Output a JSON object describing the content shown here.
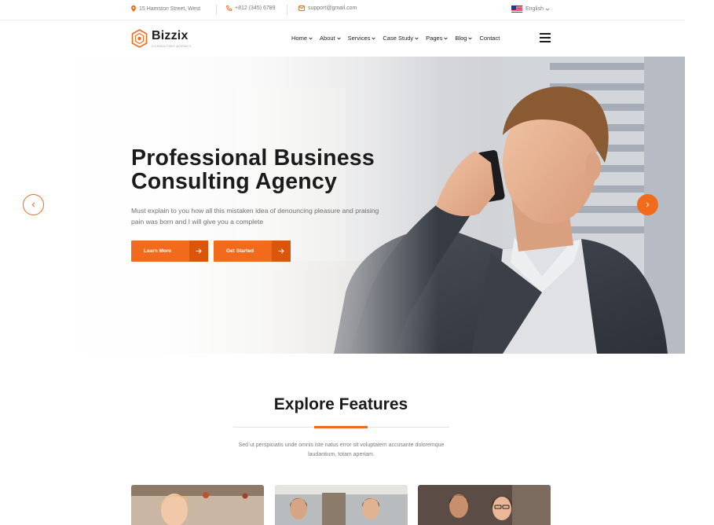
{
  "topbar": {
    "address": "15 Hamston Street, West",
    "phone": "+812 (345) 6789",
    "email": "support@gmail.com",
    "language": "English"
  },
  "brand": {
    "name": "Bizzix",
    "tagline": "Consulting Agency",
    "accent_color": "#f26a1b"
  },
  "nav": {
    "items": [
      {
        "label": "Home",
        "dropdown": true
      },
      {
        "label": "About",
        "dropdown": true
      },
      {
        "label": "Services",
        "dropdown": true
      },
      {
        "label": "Case Study",
        "dropdown": true
      },
      {
        "label": "Pages",
        "dropdown": true
      },
      {
        "label": "Blog",
        "dropdown": true
      },
      {
        "label": "Contact",
        "dropdown": false
      }
    ],
    "menu_icon": "hamburger-icon"
  },
  "hero": {
    "title_line1": "Professional Business",
    "title_line2": "Consulting Agency",
    "description": "Must explain to you how all this mistaken idea of denouncing pleasure and praising pain was born and I will give you a complete",
    "primary_button": "Learn More",
    "secondary_button": "Get Started",
    "prev_icon": "chevron-left-icon",
    "next_icon": "chevron-right-icon"
  },
  "features": {
    "title": "Explore Features",
    "description": "Sed ut perspiciatis unde omnis iste natus error sit voluptatem accusante doloremque laudantium, totam aperiam."
  }
}
